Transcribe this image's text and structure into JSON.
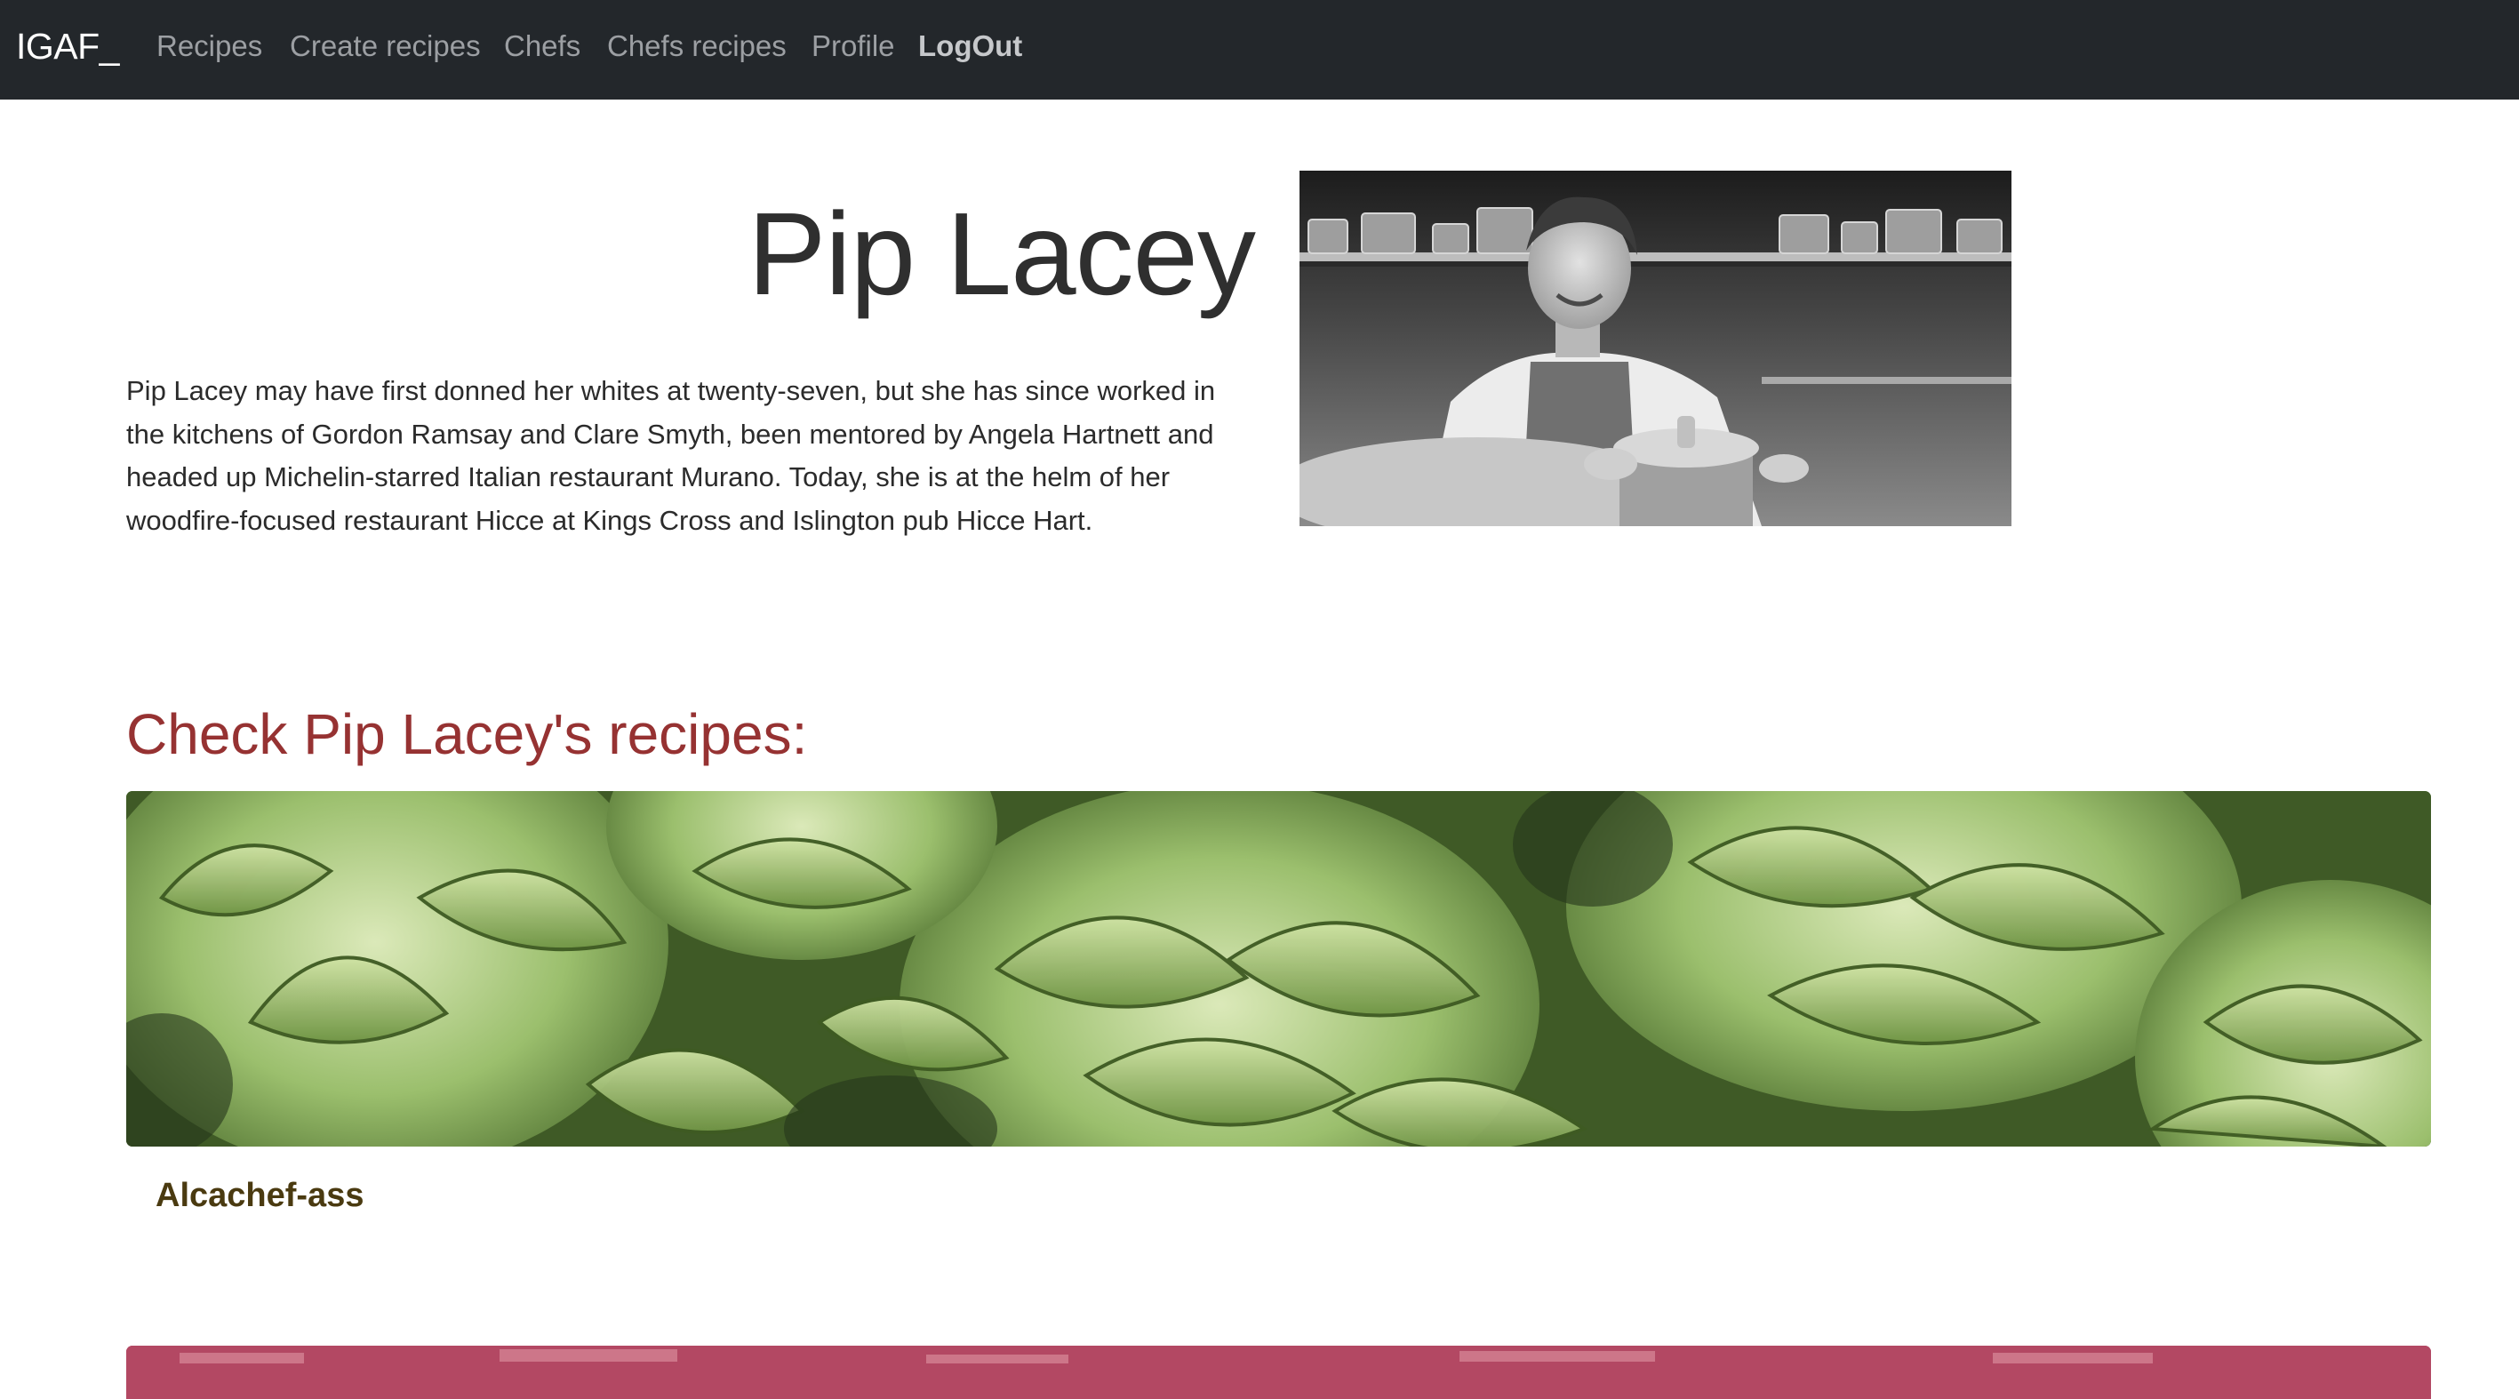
{
  "navbar": {
    "brand": "IGAF_",
    "links": [
      {
        "label": "Recipes"
      },
      {
        "label": "Create recipes"
      },
      {
        "label": "Chefs"
      },
      {
        "label": "Chefs recipes"
      },
      {
        "label": "Profile"
      },
      {
        "label": "LogOut"
      }
    ]
  },
  "chef": {
    "name": "Pip Lacey",
    "bio": "Pip Lacey may have first donned her whites at twenty-seven, but she has since worked in the kitchens of Gordon Ramsay and Clare Smyth, been mentored by Angela Hartnett and headed up Michelin-starred Italian restaurant Murano. Today, she is at the helm of her woodfire-focused restaurant Hicce at Kings Cross and Islington pub Hicce Hart.",
    "photo_alt": "Pip Lacey"
  },
  "recipes_section": {
    "heading": "Check Pip Lacey's recipes:",
    "recipes": [
      {
        "title": "Alcachef-ass",
        "image_alt": "Alcachef-ass"
      }
    ]
  },
  "colors": {
    "navbar_bg": "#23272b",
    "heading_red": "#963232",
    "recipe_title": "#4a3a10"
  }
}
